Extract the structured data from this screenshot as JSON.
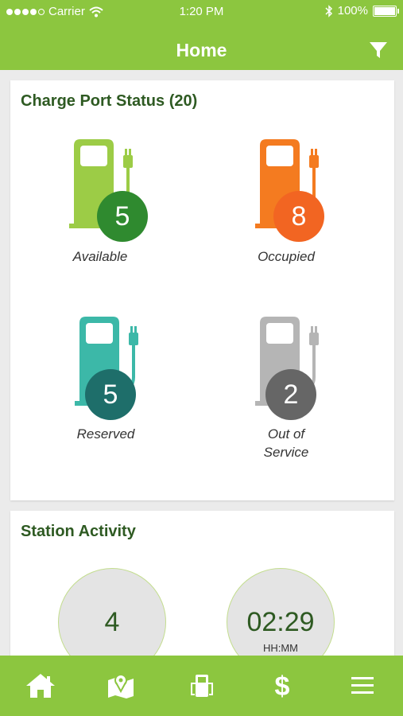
{
  "status_bar": {
    "carrier": "Carrier",
    "time": "1:20 PM",
    "battery": "100%"
  },
  "header": {
    "title": "Home"
  },
  "charge_port_status": {
    "title": "Charge Port Status (20)",
    "ports": [
      {
        "label": "Available",
        "count": "5",
        "pump_color": "#9ccc46",
        "badge_color": "#2f8a2f"
      },
      {
        "label": "Occupied",
        "count": "8",
        "pump_color": "#f47b20",
        "badge_color": "#f26522"
      },
      {
        "label": "Reserved",
        "count": "5",
        "pump_color": "#3cb8a8",
        "badge_color": "#1e6e6a"
      },
      {
        "label": "Out of Service",
        "count": "2",
        "pump_color": "#b5b5b5",
        "badge_color": "#666666"
      }
    ]
  },
  "station_activity": {
    "title": "Station Activity",
    "metrics": [
      {
        "value": "4",
        "unit": ""
      },
      {
        "value": "02:29",
        "unit": "HH:MM"
      }
    ]
  },
  "tabbar": {
    "icons": [
      "home-icon",
      "map-icon",
      "charger-icon",
      "dollar-icon",
      "menu-icon"
    ]
  }
}
